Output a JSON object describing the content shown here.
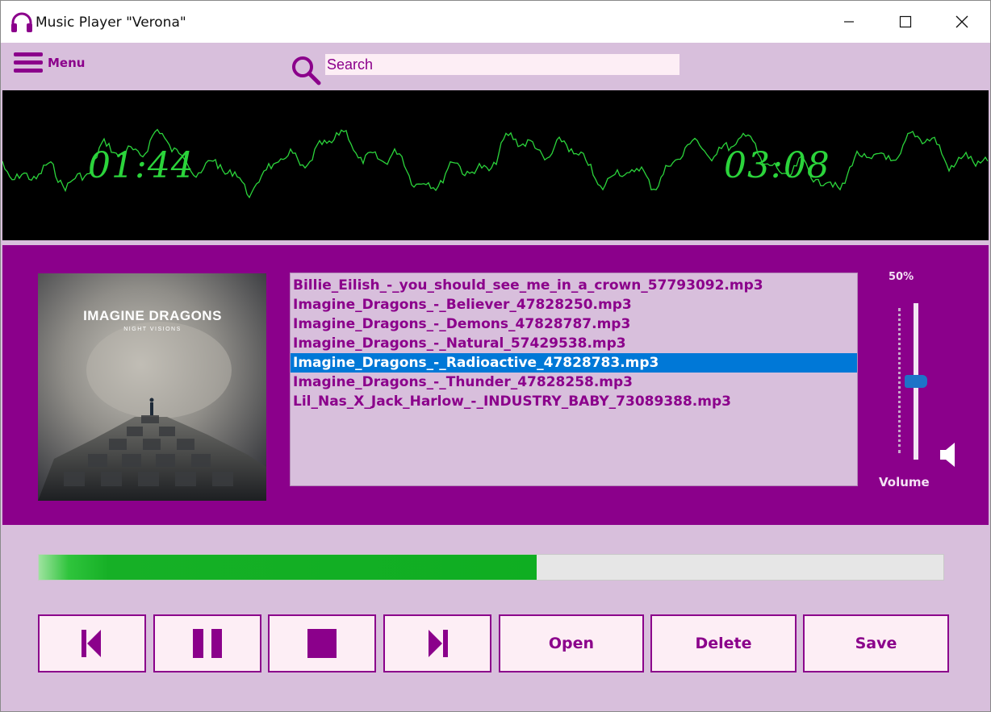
{
  "window": {
    "title": "Music Player \"Verona\""
  },
  "header": {
    "menu_label": "Menu",
    "search_placeholder": "Search",
    "search_value": ""
  },
  "display": {
    "elapsed": "01:44",
    "total": "03:08"
  },
  "album": {
    "artist_text": "IMAGINE DRAGONS",
    "album_text": "NIGHT VISIONS"
  },
  "playlist": {
    "tracks": [
      "Billie_Eilish_-_you_should_see_me_in_a_crown_57793092.mp3",
      "Imagine_Dragons_-_Believer_47828250.mp3",
      "Imagine_Dragons_-_Demons_47828787.mp3",
      "Imagine_Dragons_-_Natural_57429538.mp3",
      "Imagine_Dragons_-_Radioactive_47828783.mp3",
      "Imagine_Dragons_-_Thunder_47828258.mp3",
      "Lil_Nas_X_Jack_Harlow_-_INDUSTRY_BABY_73089388.mp3"
    ],
    "selected_index": 4
  },
  "volume": {
    "percent_label": "50%",
    "label": "Volume",
    "level": 0.5
  },
  "progress": {
    "fraction": 0.55
  },
  "controls": {
    "open_label": "Open",
    "delete_label": "Delete",
    "save_label": "Save",
    "icons": [
      "previous-icon",
      "pause-icon",
      "stop-icon",
      "next-icon"
    ]
  },
  "colors": {
    "accent": "#8b008b",
    "light": "#d8bfdc",
    "button_bg": "#fdeef5",
    "waveform": "#2bd43b",
    "selection": "#0078d7",
    "progress": "#16b026"
  }
}
